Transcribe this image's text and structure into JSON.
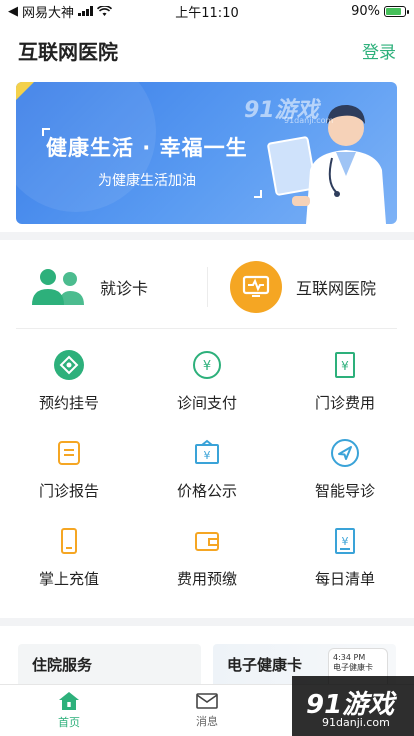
{
  "status_bar": {
    "carrier": "网易大神",
    "time": "上午11:10",
    "battery_text": "90%",
    "battery_level": 0.9
  },
  "header": {
    "title": "互联网医院",
    "login_label": "登录"
  },
  "banner": {
    "title": "健康生活 · 幸福一生",
    "subtitle": "为健康生活加油",
    "watermark": "91游戏",
    "watermark_sub": "91danji.com"
  },
  "cards": [
    {
      "label": "就诊卡",
      "icon": "users-icon"
    },
    {
      "label": "互联网医院",
      "icon": "monitor-icon"
    }
  ],
  "grid": [
    {
      "label": "预约挂号",
      "icon": "register-icon",
      "color": "#2db07b"
    },
    {
      "label": "诊间支付",
      "icon": "yuan-circle-icon",
      "color": "#2db07b"
    },
    {
      "label": "门诊费用",
      "icon": "yuan-doc-icon",
      "color": "#2db07b"
    },
    {
      "label": "门诊报告",
      "icon": "report-icon",
      "color": "#f5a623"
    },
    {
      "label": "价格公示",
      "icon": "yuan-board-icon",
      "color": "#3aa3d8"
    },
    {
      "label": "智能导诊",
      "icon": "compass-icon",
      "color": "#3aa3d8"
    },
    {
      "label": "掌上充值",
      "icon": "phone-icon",
      "color": "#f5a623"
    },
    {
      "label": "费用预缴",
      "icon": "wallet-icon",
      "color": "#f5a623"
    },
    {
      "label": "每日清单",
      "icon": "yuan-list-icon",
      "color": "#3aa3d8"
    }
  ],
  "services": [
    {
      "label": "住院服务"
    },
    {
      "label": "电子健康卡",
      "phone_time": "4:34 PM",
      "phone_text": "电子健康卡"
    }
  ],
  "tabbar": [
    {
      "label": "首页",
      "icon": "home-icon",
      "active": true
    },
    {
      "label": "消息",
      "icon": "mail-icon",
      "active": false
    }
  ],
  "watermark": {
    "logo": "91游戏",
    "url": "91danji.com"
  },
  "colors": {
    "accent": "#2db07b",
    "orange": "#f5a623",
    "blue": "#3a7ee8"
  }
}
